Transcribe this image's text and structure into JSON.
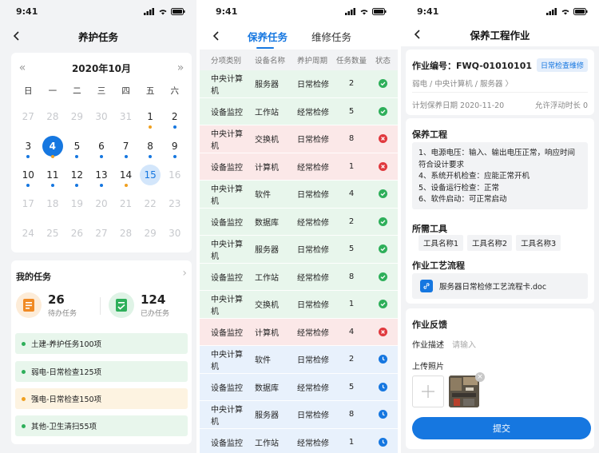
{
  "status": {
    "time": "9:41"
  },
  "screen1": {
    "title": "养护任务",
    "calendar": {
      "month": "2020年10月",
      "prev": "«",
      "next": "»",
      "weekdays": [
        "日",
        "一",
        "二",
        "三",
        "四",
        "五",
        "六"
      ],
      "days": [
        {
          "d": "27",
          "m": true
        },
        {
          "d": "28",
          "m": true
        },
        {
          "d": "29",
          "m": true
        },
        {
          "d": "30",
          "m": true
        },
        {
          "d": "31",
          "m": true
        },
        {
          "d": "1",
          "dot": "orange"
        },
        {
          "d": "2",
          "dot": "blue"
        },
        {
          "d": "3",
          "dot": "blue"
        },
        {
          "d": "4",
          "today": true,
          "dot": "orange"
        },
        {
          "d": "5",
          "dot": "blue"
        },
        {
          "d": "6",
          "dot": "blue"
        },
        {
          "d": "7",
          "dot": "blue"
        },
        {
          "d": "8",
          "dot": "blue"
        },
        {
          "d": "9",
          "dot": "blue"
        },
        {
          "d": "10",
          "dot": "blue"
        },
        {
          "d": "11",
          "dot": "blue"
        },
        {
          "d": "12",
          "dot": "blue"
        },
        {
          "d": "13",
          "dot": "blue"
        },
        {
          "d": "14",
          "dot": "orange"
        },
        {
          "d": "15",
          "selected": true
        },
        {
          "d": "16",
          "m": true
        },
        {
          "d": "17",
          "m": true
        },
        {
          "d": "18",
          "m": true
        },
        {
          "d": "19",
          "m": true
        },
        {
          "d": "20",
          "m": true
        },
        {
          "d": "21",
          "m": true
        },
        {
          "d": "22",
          "m": true
        },
        {
          "d": "23",
          "m": true
        },
        {
          "d": "24",
          "m": true
        },
        {
          "d": "25",
          "m": true
        },
        {
          "d": "26",
          "m": true
        },
        {
          "d": "27",
          "m": true
        },
        {
          "d": "28",
          "m": true
        },
        {
          "d": "29",
          "m": true
        },
        {
          "d": "30",
          "m": true
        }
      ]
    },
    "my_tasks": {
      "title": "我的任务",
      "more": "›",
      "pending_count": "26",
      "pending_label": "待办任务",
      "done_count": "124",
      "done_label": "已办任务",
      "items": [
        {
          "label": "土建-养护任务100项",
          "color": "#2eaf5a",
          "bg": "#e8f6ec"
        },
        {
          "label": "弱电-日常检查125项",
          "color": "#2eaf5a",
          "bg": "#e8f6ec"
        },
        {
          "label": "强电-日常检查150项",
          "color": "#f0a020",
          "bg": "#fdf3e1"
        },
        {
          "label": "其他-卫生清扫55项",
          "color": "#2eaf5a",
          "bg": "#e8f6ec"
        }
      ]
    }
  },
  "screen2": {
    "tab_active": "保养任务",
    "tab_inactive": "维修任务",
    "headers": [
      "分项类别",
      "设备名称",
      "养护周期",
      "任务数量",
      "状态"
    ],
    "rows": [
      {
        "c": "中央计算机",
        "n": "服务器",
        "p": "日常检修",
        "q": "2",
        "s": "ok"
      },
      {
        "c": "设备监控",
        "n": "工作站",
        "p": "经常检修",
        "q": "5",
        "s": "ok"
      },
      {
        "c": "中央计算机",
        "n": "交换机",
        "p": "日常检修",
        "q": "8",
        "s": "err"
      },
      {
        "c": "设备监控",
        "n": "计算机",
        "p": "经常检修",
        "q": "1",
        "s": "err"
      },
      {
        "c": "中央计算机",
        "n": "软件",
        "p": "日常检修",
        "q": "4",
        "s": "ok"
      },
      {
        "c": "设备监控",
        "n": "数据库",
        "p": "经常检修",
        "q": "2",
        "s": "ok"
      },
      {
        "c": "中央计算机",
        "n": "服务器",
        "p": "日常检修",
        "q": "5",
        "s": "ok"
      },
      {
        "c": "设备监控",
        "n": "工作站",
        "p": "经常检修",
        "q": "8",
        "s": "ok"
      },
      {
        "c": "中央计算机",
        "n": "交换机",
        "p": "日常检修",
        "q": "1",
        "s": "ok"
      },
      {
        "c": "设备监控",
        "n": "计算机",
        "p": "经常检修",
        "q": "4",
        "s": "err"
      },
      {
        "c": "中央计算机",
        "n": "软件",
        "p": "日常检修",
        "q": "2",
        "s": "clock"
      },
      {
        "c": "设备监控",
        "n": "数据库",
        "p": "经常检修",
        "q": "5",
        "s": "clock"
      },
      {
        "c": "中央计算机",
        "n": "服务器",
        "p": "日常检修",
        "q": "8",
        "s": "clock"
      },
      {
        "c": "设备监控",
        "n": "工作站",
        "p": "经常检修",
        "q": "1",
        "s": "clock"
      }
    ]
  },
  "screen3": {
    "title": "保养工程作业",
    "job_no": "作业编号：FWQ-01010101",
    "badge": "日常检查维修",
    "breadcrumb": "弱电 / 中央计算机 / 服务器 〉",
    "plan_date": "计划保养日期 2020-11-20",
    "float": "允许浮动时长 0",
    "project_title": "保养工程",
    "project_lines": [
      "1、电源电压：输入、输出电压正常，响应时间符合设计要求",
      "4、系统开机检查：应能正常开机",
      "5、设备运行检查：正常",
      "6、软件启动：可正常启动"
    ],
    "tools_title": "所需工具",
    "tools": [
      "工具名称1",
      "工具名称2",
      "工具名称3"
    ],
    "flow_title": "作业工艺流程",
    "flow_file": "服务器日常检修工艺流程卡.doc",
    "feedback_title": "作业反馈",
    "desc_label": "作业描述",
    "desc_placeholder": "请输入",
    "photo_label": "上传照片",
    "submit": "提交"
  }
}
